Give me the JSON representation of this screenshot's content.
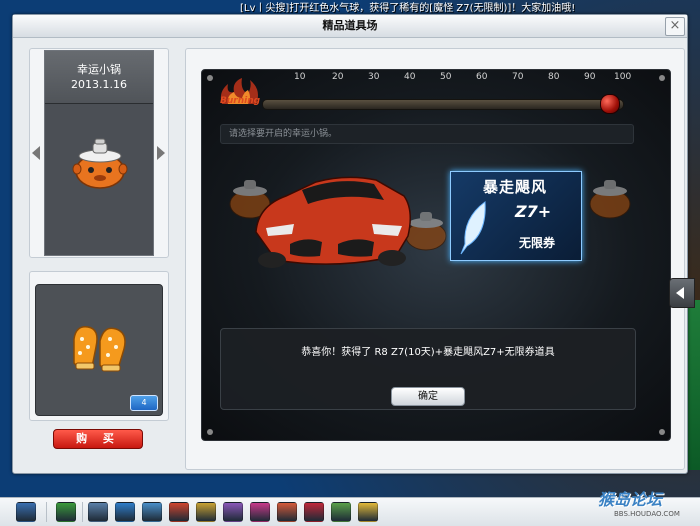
{
  "ticker": "[Lv丨尖搜]打开红色水气球，获得了稀有的[魔怪 Z7(无限制)]！大家加油哦!",
  "window": {
    "title": "精品道具场",
    "close_label": "×"
  },
  "item_panel": {
    "name": "幸运小锅",
    "date": "2013.1.16"
  },
  "item_slot": {
    "count": "4",
    "buy_label": "购 买"
  },
  "progress": {
    "ticks": [
      "10",
      "20",
      "30",
      "40",
      "50",
      "60",
      "70",
      "80",
      "90",
      "100"
    ],
    "label": "Burning",
    "value_percent": 100
  },
  "prompt": "请选择要开启的幸运小锅。",
  "coupon": {
    "title": "暴走飓风",
    "model": "Z7+",
    "subtitle": "无限券"
  },
  "result": {
    "message": "恭喜你！获得了 R8 Z7(10天)+暴走飓风Z7+无限券道具",
    "ok_label": "确定"
  },
  "watermark": {
    "text": "猴岛论坛",
    "url": "BBS.HOUDAO.COM"
  },
  "taskbar": {
    "icons": [
      "start-icon",
      "back-icon",
      "save-icon",
      "home-icon",
      "tools-icon",
      "car-icon",
      "gift-icon",
      "friends-icon",
      "mail-icon",
      "book-icon",
      "dice-icon",
      "notes-icon",
      "settings-icon"
    ],
    "icon_colors": [
      "#3a6fb0",
      "#3b9a3b",
      "#5a7fa8",
      "#2f7dc9",
      "#4a8fc9",
      "#d0452e",
      "#c9a233",
      "#8a57b8",
      "#c93a8a",
      "#d45a3a",
      "#c0283a",
      "#5aa04a",
      "#e2b93a"
    ]
  }
}
